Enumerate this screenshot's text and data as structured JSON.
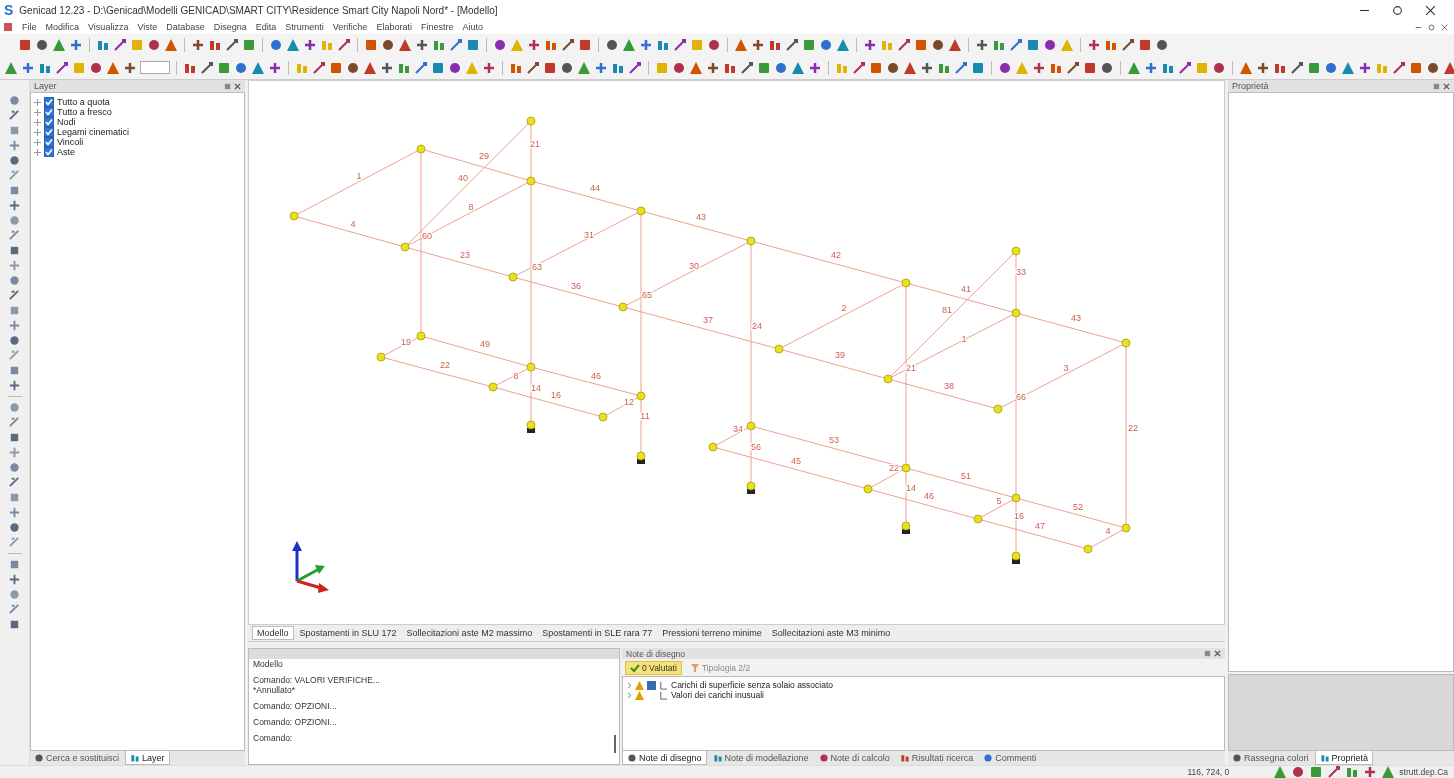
{
  "window": {
    "app_logo": "S",
    "title": "Genicad 12.23 - D:\\Genicad\\Modelli GENICAD\\SMART CITY\\Residence Smart City Napoli Nord* - [Modello]"
  },
  "menu": [
    "File",
    "Modifica",
    "Visualizza",
    "Viste",
    "Database",
    "Disegna",
    "Edita",
    "Strumenti",
    "Verifiche",
    "Elaborati",
    "Finestre",
    "Aiuto"
  ],
  "layers_panel": {
    "title": "Layer",
    "items": [
      {
        "label": "Tutto a quota",
        "checked": true
      },
      {
        "label": "Tutto a fresco",
        "checked": true
      },
      {
        "label": "Nodi",
        "checked": true
      },
      {
        "label": "Legami cinematici",
        "checked": true
      },
      {
        "label": "Vincoli",
        "checked": true
      },
      {
        "label": "Aste",
        "checked": true
      }
    ]
  },
  "model_view": {
    "labels": [
      "1",
      "4",
      "29",
      "40",
      "21",
      "8",
      "60",
      "44",
      "23",
      "63",
      "31",
      "43",
      "36",
      "65",
      "30",
      "42",
      "37",
      "24",
      "2",
      "39",
      "21",
      "41",
      "81",
      "33",
      "1",
      "38",
      "66",
      "43",
      "3",
      "22",
      "19",
      "49",
      "22",
      "8",
      "46",
      "14",
      "16",
      "12",
      "11",
      "34",
      "56",
      "45",
      "53",
      "22",
      "14",
      "46",
      "51",
      "5",
      "52",
      "16",
      "47",
      "4"
    ]
  },
  "view_tabs": [
    {
      "label": "Modello",
      "selected": true
    },
    {
      "label": "Spostamenti in SLU 172",
      "selected": false
    },
    {
      "label": "Sollecitazioni aste M2 massimo",
      "selected": false
    },
    {
      "label": "Spostamenti in SLE rara 77",
      "selected": false
    },
    {
      "label": "Pressioni terreno minime",
      "selected": false
    },
    {
      "label": "Sollecitazioni aste M3 minimo",
      "selected": false
    }
  ],
  "command_panel": {
    "lines": [
      "Modello",
      "Comando: VALORI VERIFICHE...",
      "*Annullato*",
      "Comando: OPZIONI...",
      "Comando: OPZIONI...",
      "Comando:"
    ]
  },
  "notes_panel": {
    "title": "Note di disegno",
    "tabs": [
      {
        "label": "0 Valutati",
        "selected": true
      },
      {
        "label": "Tipologia 2/2",
        "selected": false
      }
    ],
    "items": [
      {
        "label": "Carichi di superficie senza solaio associato"
      },
      {
        "label": "Valori dei carichi inusuali"
      }
    ],
    "bottom_tabs": [
      {
        "label": "Note di disegno",
        "selected": true
      },
      {
        "label": "Note di modellazione",
        "selected": false
      },
      {
        "label": "Note di calcolo",
        "selected": false
      },
      {
        "label": "Risultati ricerca",
        "selected": false
      },
      {
        "label": "Commenti",
        "selected": false
      }
    ]
  },
  "properties_panel": {
    "title": "Proprietà",
    "tabs": [
      {
        "label": "Rassegna colori",
        "selected": false
      },
      {
        "label": "Proprietà",
        "selected": true
      }
    ]
  },
  "left_tabs": [
    {
      "label": "Cerca e sostituisci",
      "selected": false
    },
    {
      "label": "Layer",
      "selected": true
    }
  ],
  "status_bar": {
    "coordinates": "116, 724, 0",
    "mode": "strutt.dep.Ca"
  }
}
